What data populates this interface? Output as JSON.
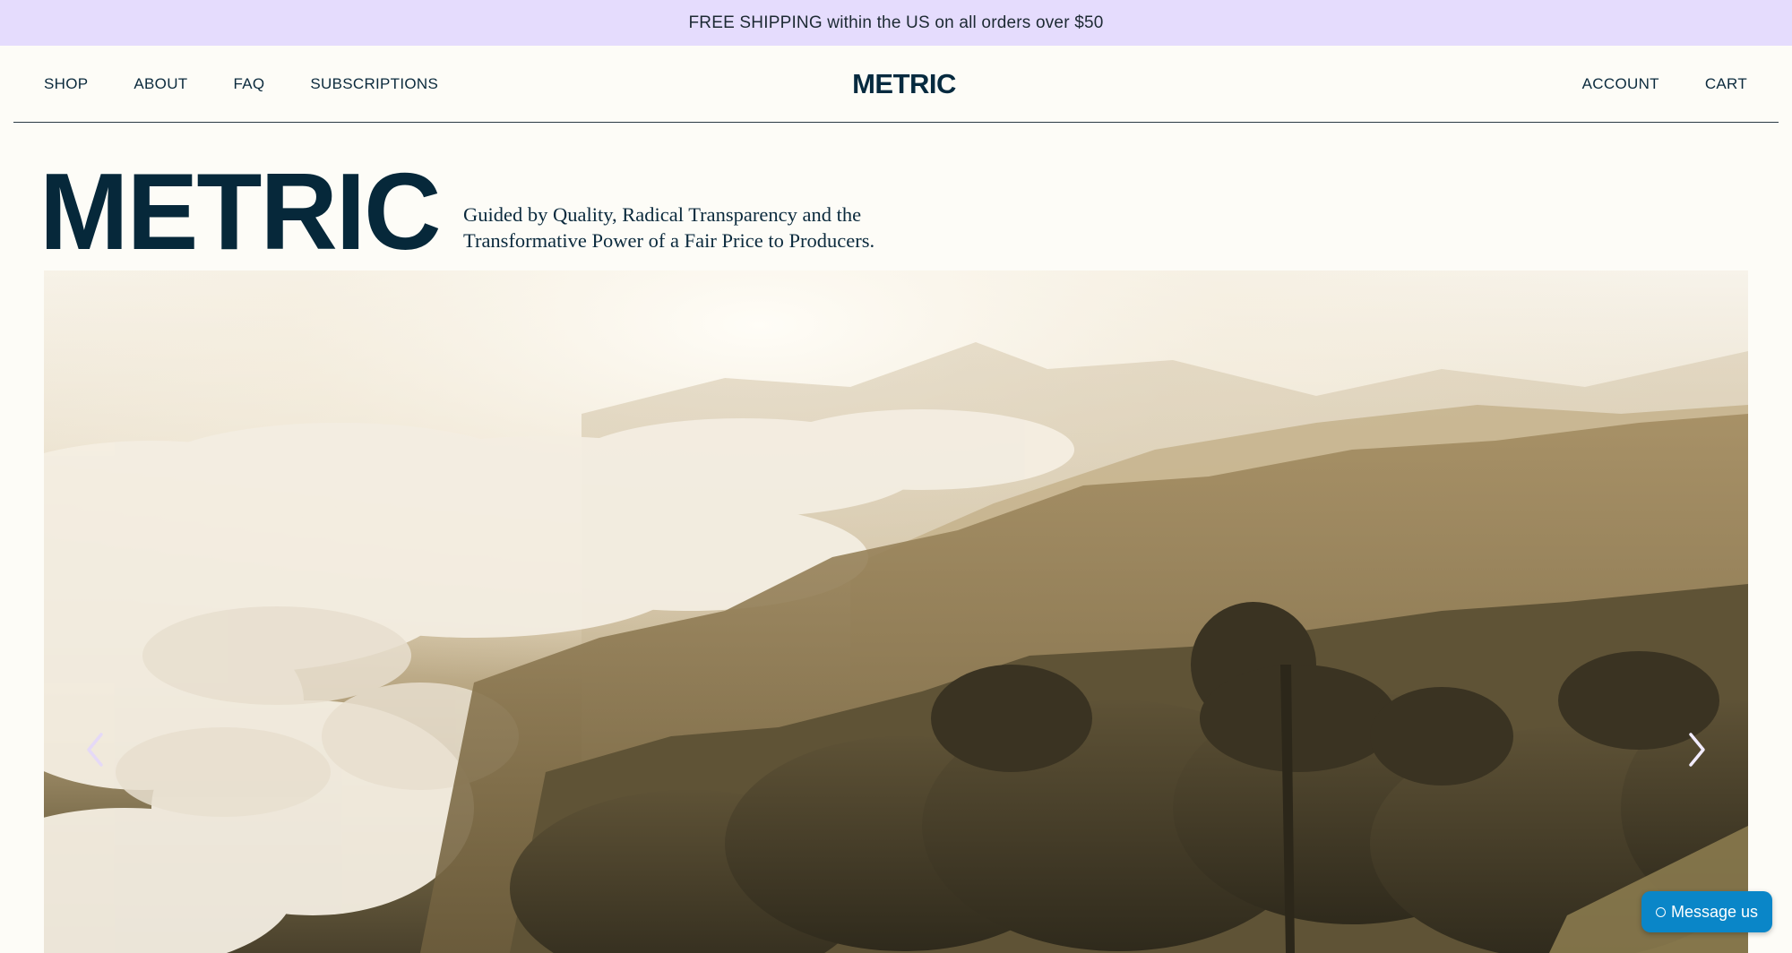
{
  "announcement": {
    "text": "FREE SHIPPING within the US on all orders over $50"
  },
  "header": {
    "nav_left": [
      {
        "label": "SHOP"
      },
      {
        "label": "ABOUT"
      },
      {
        "label": "FAQ"
      },
      {
        "label": "SUBSCRIPTIONS"
      }
    ],
    "logo": "METRIC",
    "nav_right": [
      {
        "label": "ACCOUNT"
      },
      {
        "label": "CART"
      }
    ]
  },
  "hero": {
    "title": "METRIC",
    "tagline_line1": "Guided by Quality, Radical Transparency and the",
    "tagline_line2": "Transformative Power of a Fair Price to Producers.",
    "prev_icon": "chevron-left-icon",
    "next_icon": "chevron-right-icon"
  },
  "chat": {
    "label": "Message us",
    "icon": "chat-bubble-icon"
  },
  "colors": {
    "announcement_bg": "#e5dcfd",
    "page_bg": "#fdfcf7",
    "brand_navy": "#06283a",
    "chat_blue": "#0a86c8"
  }
}
